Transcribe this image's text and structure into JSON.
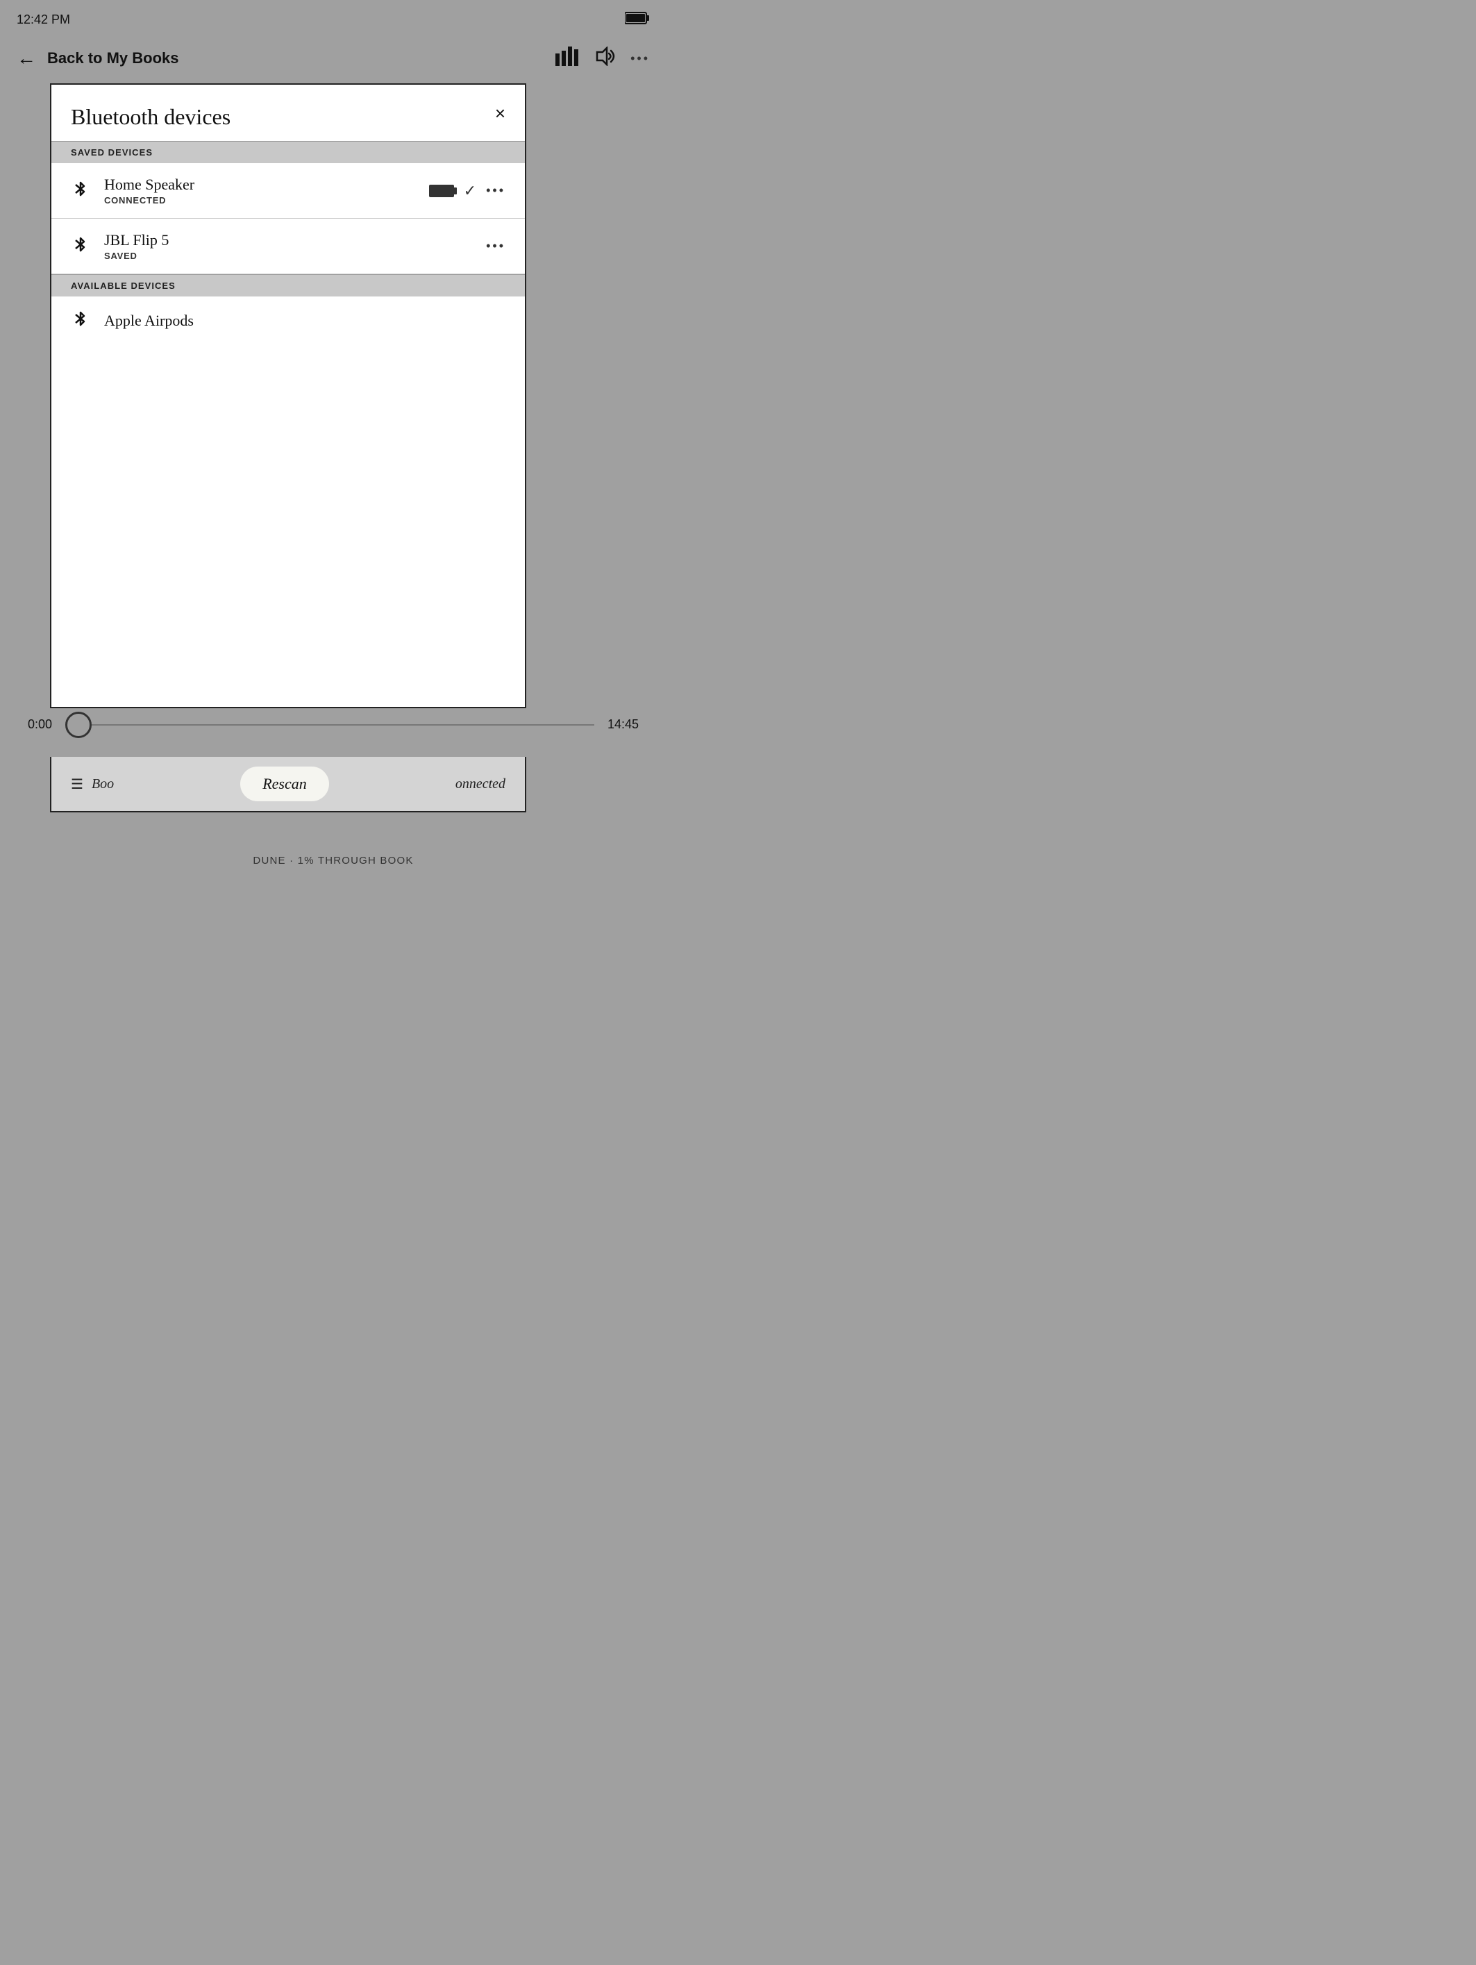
{
  "statusBar": {
    "time": "12:42 PM",
    "battery": "🔋"
  },
  "navBar": {
    "backLabel": "Back to My Books",
    "icons": {
      "chart": "chart-icon",
      "volume": "volume-icon",
      "more": "more-icon"
    }
  },
  "modal": {
    "title": "Bluetooth devices",
    "closeLabel": "×",
    "savedSection": {
      "header": "SAVED DEVICES",
      "devices": [
        {
          "name": "Home Speaker",
          "status": "CONNECTED",
          "hasBattery": true,
          "hasCheck": true,
          "hasMore": true
        },
        {
          "name": "JBL Flip 5",
          "status": "SAVED",
          "hasBattery": false,
          "hasCheck": false,
          "hasMore": true
        }
      ]
    },
    "availableSection": {
      "header": "AVAILABLE DEVICES",
      "devices": [
        {
          "name": "Apple Airpods",
          "status": "",
          "hasBattery": false,
          "hasCheck": false,
          "hasMore": false
        }
      ]
    }
  },
  "progressBar": {
    "timeStart": "0:00",
    "timeEnd": "14:45"
  },
  "bottomBar": {
    "listLabel": "Boo",
    "rescanLabel": "Rescan",
    "connectedLabel": "onnected"
  },
  "footer": {
    "text": "DUNE · 1% THROUGH BOOK"
  }
}
